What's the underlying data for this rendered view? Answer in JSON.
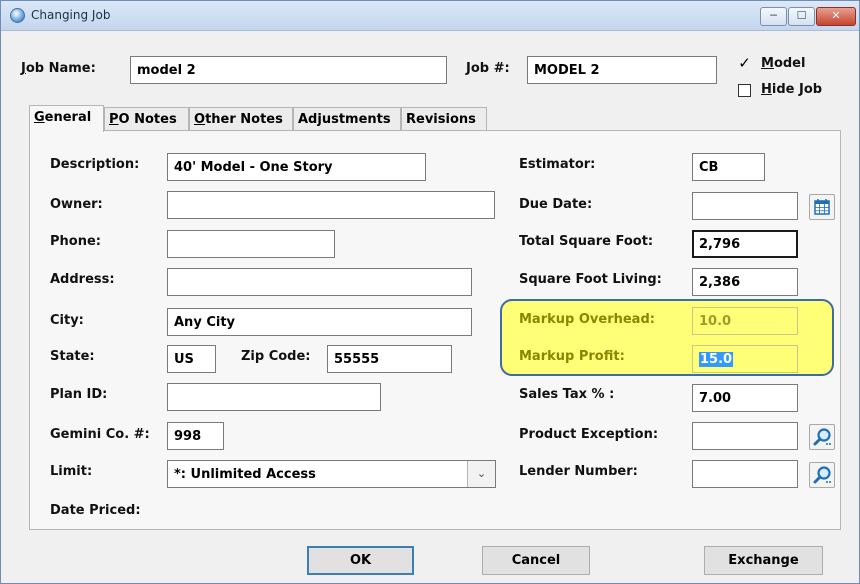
{
  "window": {
    "title": "Changing Job",
    "min": "─",
    "max": "☐",
    "close": "✕"
  },
  "header": {
    "job_name_label": "Job Name:",
    "job_name_accel": "J",
    "job_name_rest": "ob Name:",
    "job_name_value": "model 2",
    "job_no_label": "Job #:",
    "job_no_value": "MODEL 2",
    "model_label": "Model",
    "model_accel": "M",
    "model_rest": "odel",
    "model_checked": "✓",
    "hide_job_label": "Hide Job",
    "hide_job_accel": "H",
    "hide_job_rest": "ide Job"
  },
  "tabs": [
    {
      "label": "General",
      "accel": "G",
      "rest": "eneral",
      "active": true
    },
    {
      "label": "PO Notes",
      "accel": "P",
      "rest": "O Notes"
    },
    {
      "label": "Other Notes",
      "accel": "O",
      "rest": "ther Notes"
    },
    {
      "label": "Adjustments",
      "accel": "",
      "rest": "Adjustments"
    },
    {
      "label": "Revisions",
      "accel": "",
      "rest": "Revisions"
    }
  ],
  "left": {
    "description": {
      "label": "Description:",
      "value": "40' Model - One Story"
    },
    "owner": {
      "label": "Owner:",
      "value": ""
    },
    "phone": {
      "label": "Phone:",
      "value": ""
    },
    "address": {
      "label": "Address:",
      "value": ""
    },
    "city": {
      "label": "City:",
      "value": "Any City"
    },
    "state": {
      "label": "State:",
      "value": "US"
    },
    "zip": {
      "label": "Zip Code:",
      "value": "55555"
    },
    "plan_id": {
      "label": "Plan ID:",
      "value": ""
    },
    "gemini": {
      "label": "Gemini Co. #:",
      "value": "998"
    },
    "limit": {
      "label": "Limit:",
      "value": "*: Unlimited Access"
    },
    "date_priced": {
      "label": "Date Priced:"
    }
  },
  "right": {
    "estimator": {
      "label": "Estimator:",
      "value": "CB"
    },
    "due_date": {
      "label": "Due Date:",
      "value": ""
    },
    "total_sqft": {
      "label": "Total Square Foot:",
      "value": "2,796"
    },
    "sqft_living": {
      "label": "Square Foot Living:",
      "value": "2,386"
    },
    "markup_overhead": {
      "label": "Markup Overhead:",
      "value": "10.0"
    },
    "markup_profit": {
      "label": "Markup Profit:",
      "value": "15.0"
    },
    "sales_tax": {
      "label": "Sales Tax % :",
      "value": "7.00"
    },
    "product_exception": {
      "label": "Product Exception:",
      "value": ""
    },
    "lender_number": {
      "label": "Lender Number:",
      "value": ""
    }
  },
  "buttons": {
    "ok": "OK",
    "cancel": "Cancel",
    "exchange": "Exchange"
  },
  "colors": {
    "highlight": "#ffff77",
    "highlight_border": "#3e6aa6",
    "selection": "#3399ff"
  }
}
